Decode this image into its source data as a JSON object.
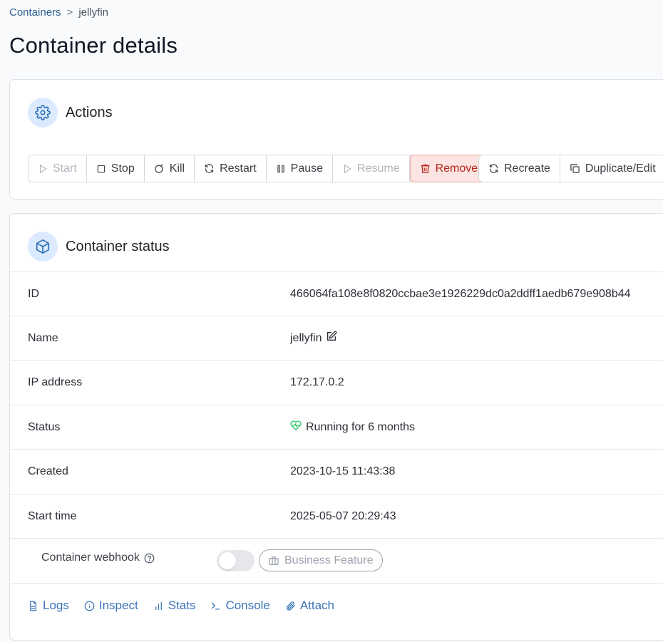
{
  "breadcrumb": {
    "parent": "Containers",
    "separator": ">",
    "current": "jellyfin"
  },
  "page_title": "Container details",
  "actions": {
    "title": "Actions",
    "buttons": {
      "start": "Start",
      "stop": "Stop",
      "kill": "Kill",
      "restart": "Restart",
      "pause": "Pause",
      "resume": "Resume",
      "remove": "Remove"
    },
    "secondary": {
      "recreate": "Recreate",
      "duplicate": "Duplicate/Edit"
    }
  },
  "status": {
    "title": "Container status",
    "rows": [
      {
        "label": "ID",
        "value": "466064fa108e8f0820ccbae3e1926229dc0a2ddff1aedb679e908b44"
      },
      {
        "label": "Name",
        "value": "jellyfin"
      },
      {
        "label": "IP address",
        "value": "172.17.0.2"
      },
      {
        "label": "Status",
        "value": "Running for 6 months"
      },
      {
        "label": "Created",
        "value": "2023-10-15 11:43:38"
      },
      {
        "label": "Start time",
        "value": "2025-05-07 20:29:43"
      }
    ],
    "webhook": {
      "label": "Container webhook",
      "enabled": false,
      "badge": "Business Feature"
    }
  },
  "links": {
    "logs": "Logs",
    "inspect": "Inspect",
    "stats": "Stats",
    "console": "Console",
    "attach": "Attach"
  },
  "colors": {
    "accent": "#3b74b8",
    "danger": "#b42318",
    "running": "#22c55e"
  }
}
